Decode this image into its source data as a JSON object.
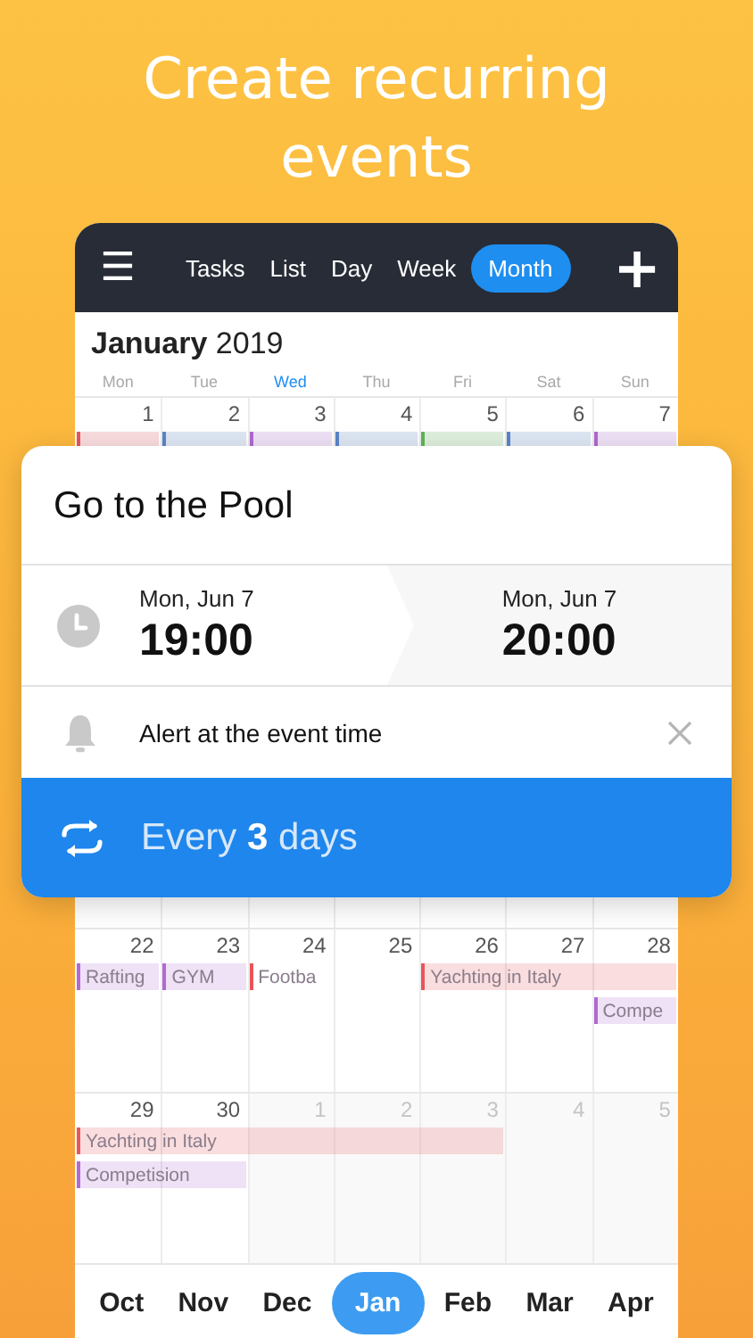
{
  "headline": "Create recurring events",
  "toolbar": {
    "menu_icon": "☰",
    "add_icon": "+",
    "tabs": [
      {
        "label": "Tasks",
        "selected": false
      },
      {
        "label": "List",
        "selected": false
      },
      {
        "label": "Day",
        "selected": false
      },
      {
        "label": "Week",
        "selected": false
      },
      {
        "label": "Month",
        "selected": true
      }
    ]
  },
  "calendar": {
    "title": "**January** 2019",
    "weekdays": [
      {
        "label": "Mon",
        "today": false
      },
      {
        "label": "Tue",
        "today": false
      },
      {
        "label": "Wed",
        "today": true
      },
      {
        "label": "Thu",
        "today": false
      },
      {
        "label": "Fri",
        "today": false
      },
      {
        "label": "Sat",
        "today": false
      },
      {
        "label": "Sun",
        "today": false
      }
    ],
    "weeks": [
      {
        "days": [
          {
            "date": "1",
            "other_month": false
          },
          {
            "date": "2",
            "other_month": false
          },
          {
            "date": "3",
            "other_month": false
          },
          {
            "date": "4",
            "other_month": false
          },
          {
            "date": "5",
            "other_month": false
          },
          {
            "date": "6",
            "other_month": false
          },
          {
            "date": "7",
            "other_month": false
          }
        ],
        "lanes": [
          [
            {
              "kind": "event",
              "color": "#e8555a",
              "filled": true
            },
            {
              "kind": "event",
              "color": "#5a86c8",
              "filled": true
            },
            {
              "kind": "event",
              "color": "#b06ad0",
              "filled": true
            },
            {
              "kind": "event",
              "color": "#5a86c8",
              "filled": true
            },
            {
              "kind": "event",
              "color": "#5fb55a",
              "filled": true
            },
            {
              "kind": "event",
              "color": "#5a86c8",
              "filled": true
            },
            {
              "kind": "event",
              "color": "#b06ad0",
              "filled": true
            }
          ]
        ]
      },
      {
        "days": [
          {
            "date": "22",
            "other_month": false
          },
          {
            "date": "23",
            "other_month": false
          },
          {
            "date": "24",
            "other_month": false
          },
          {
            "date": "25",
            "other_month": false
          },
          {
            "date": "26",
            "other_month": false
          },
          {
            "date": "27",
            "other_month": false
          },
          {
            "date": "28",
            "other_month": false
          }
        ],
        "lanes": [
          [
            {
              "kind": "event",
              "title": "Rafting",
              "color": "#b06ad0",
              "filled": true
            },
            {
              "kind": "event",
              "title": "GYM",
              "color": "#b06ad0",
              "filled": true
            },
            {
              "kind": "event",
              "title": "Footba",
              "color": "#e8555a",
              "filled": false
            },
            {
              "kind": "empty"
            },
            {
              "kind": "event",
              "title": "Yachting in Italy",
              "color": "#e8555a",
              "filled": true
            },
            {
              "kind": "continue"
            },
            {
              "kind": "continue"
            }
          ],
          [
            {
              "kind": "empty"
            },
            {
              "kind": "empty"
            },
            {
              "kind": "empty"
            },
            {
              "kind": "empty"
            },
            {
              "kind": "empty"
            },
            {
              "kind": "empty"
            },
            {
              "kind": "event",
              "title": "Compe",
              "color": "#b06ad0",
              "filled": true
            }
          ]
        ]
      },
      {
        "days": [
          {
            "date": "29",
            "other_month": false
          },
          {
            "date": "30",
            "other_month": false
          },
          {
            "date": "1",
            "other_month": true
          },
          {
            "date": "2",
            "other_month": true
          },
          {
            "date": "3",
            "other_month": true
          },
          {
            "date": "4",
            "other_month": true
          },
          {
            "date": "5",
            "other_month": true
          }
        ],
        "lanes": [
          [
            {
              "kind": "event",
              "title": "Yachting in Italy",
              "color": "#e8555a",
              "filled": true
            },
            {
              "kind": "continue"
            },
            {
              "kind": "continue"
            },
            {
              "kind": "continue"
            },
            {
              "kind": "continue"
            },
            {
              "kind": "empty"
            },
            {
              "kind": "empty"
            }
          ],
          [
            {
              "kind": "event",
              "title": "Competision",
              "color": "#b06ad0",
              "filled": true
            },
            {
              "kind": "continue"
            },
            {
              "kind": "empty"
            },
            {
              "kind": "empty"
            },
            {
              "kind": "empty"
            },
            {
              "kind": "empty"
            },
            {
              "kind": "empty"
            }
          ]
        ]
      }
    ]
  },
  "months": [
    {
      "label": "Oct",
      "selected": false
    },
    {
      "label": "Nov",
      "selected": false
    },
    {
      "label": "Dec",
      "selected": false
    },
    {
      "label": "Jan",
      "selected": true
    },
    {
      "label": "Feb",
      "selected": false
    },
    {
      "label": "Mar",
      "selected": false
    },
    {
      "label": "Apr",
      "selected": false
    }
  ],
  "event_card": {
    "title": "Go to the Pool",
    "start": {
      "date": "Mon, Jun 7",
      "time": "19:00"
    },
    "end": {
      "date": "Mon, Jun 7",
      "time": "20:00"
    },
    "alert": "Alert at the event time",
    "repeat": "Every **3** days"
  }
}
